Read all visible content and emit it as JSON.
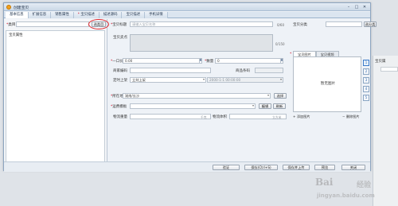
{
  "window": {
    "title": "创建宝贝"
  },
  "background": {
    "tab_label": "宝贝属"
  },
  "tabs": [
    {
      "label": "基本信息",
      "active": true,
      "required": false
    },
    {
      "label": "扩展信息",
      "active": false,
      "required": false
    },
    {
      "label": "销售属性",
      "active": false,
      "required": false
    },
    {
      "label": "宝贝描述",
      "active": false,
      "required": true
    },
    {
      "label": "描述源码",
      "active": false,
      "required": false
    },
    {
      "label": "宝贝描述",
      "active": false,
      "required": false
    },
    {
      "label": "手机详情",
      "active": false,
      "required": false
    }
  ],
  "left": {
    "category_label": "类目",
    "select_category_button": "选类目",
    "attributes_label": "宝贝属性"
  },
  "form": {
    "title_label": "宝贝标题",
    "title_placeholder": "请输入宝贝名称",
    "title_counter": "0/60",
    "selling_label": "宝贝卖点",
    "selling_counter": "0/150",
    "price_label": "一口价",
    "price_value": "0.00",
    "qty_label": "数量",
    "qty_value": "0",
    "merchant_code_label": "商家编码",
    "barcode_label": "商品条码",
    "listing_label": "定时上架",
    "listing_value": "立刻上架",
    "listing_time": "2000-1-1 00:00:00",
    "location_label": "所在地",
    "location_value": "湖南/长沙",
    "location_button": "选择",
    "shipping_label": "运费模板",
    "edit_button": "编辑",
    "refresh_button": "刷新",
    "weight_label": "物流重量",
    "weight_unit": "千克",
    "volume_label": "物流体积",
    "volume_unit": "立方米"
  },
  "right": {
    "category_label": "宝贝分类",
    "select_category_button": "选分类",
    "image_tabs": [
      "宝贝图片",
      "宝贝视频"
    ],
    "placeholder": "暂无图片",
    "add_image": "添加图片",
    "delete_image": "删除图片",
    "side_buttons": [
      "1",
      "2",
      "3",
      "4",
      "5"
    ]
  },
  "footer": {
    "verify": "验证",
    "save": "保存(Ctrl+S)",
    "save_upload": "保存并上传",
    "preview": "预览",
    "close": "关闭"
  },
  "watermark": {
    "logo": "Bai",
    "text": "经验",
    "url": "jingyan.baidu.com"
  }
}
